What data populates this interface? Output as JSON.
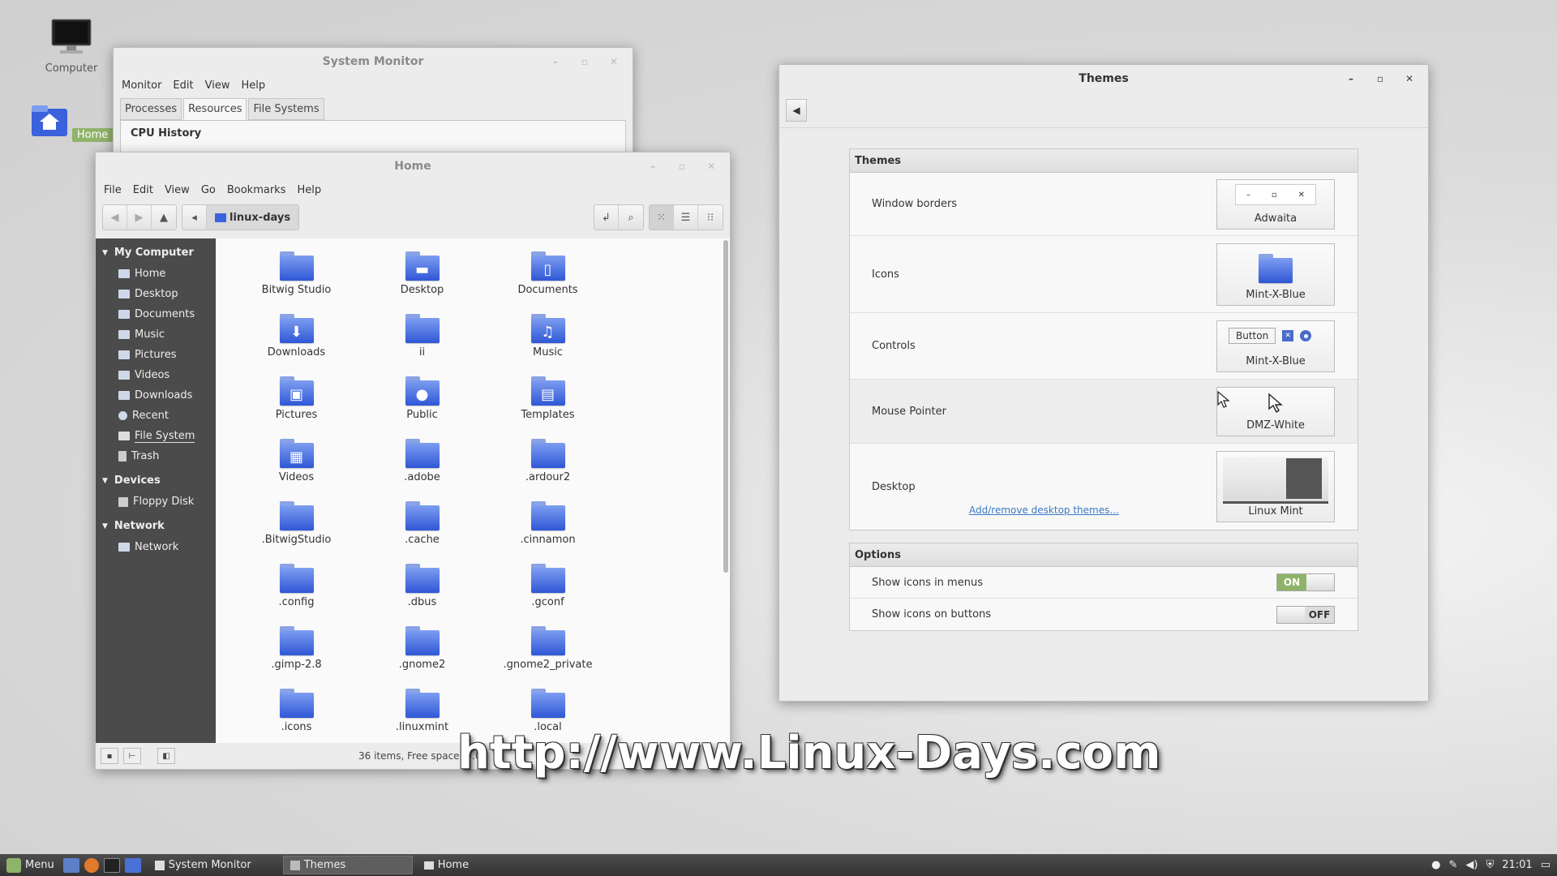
{
  "desktop": {
    "icons": [
      {
        "label": "Computer"
      },
      {
        "label": "Home"
      }
    ],
    "watermark": "http://www.Linux-Days.com"
  },
  "system_monitor": {
    "title": "System Monitor",
    "menu": [
      "Monitor",
      "Edit",
      "View",
      "Help"
    ],
    "tabs": [
      "Processes",
      "Resources",
      "File Systems"
    ],
    "active_tab": "Resources",
    "section": "CPU History"
  },
  "home": {
    "title": "Home",
    "menu": [
      "File",
      "Edit",
      "View",
      "Go",
      "Bookmarks",
      "Help"
    ],
    "path": "linux-days",
    "sidebar": {
      "my_computer": {
        "header": "My Computer",
        "items": [
          "Home",
          "Desktop",
          "Documents",
          "Music",
          "Pictures",
          "Videos",
          "Downloads",
          "Recent",
          "File System",
          "Trash"
        ]
      },
      "devices": {
        "header": "Devices",
        "items": [
          "Floppy Disk"
        ]
      },
      "network": {
        "header": "Network",
        "items": [
          "Network"
        ]
      }
    },
    "files": [
      {
        "name": "Bitwig Studio",
        "glyph": ""
      },
      {
        "name": "Desktop",
        "glyph": "▬"
      },
      {
        "name": "Documents",
        "glyph": "▯"
      },
      {
        "name": "Downloads",
        "glyph": "⬇"
      },
      {
        "name": "ii",
        "glyph": ""
      },
      {
        "name": "Music",
        "glyph": "♫"
      },
      {
        "name": "Pictures",
        "glyph": "▣"
      },
      {
        "name": "Public",
        "glyph": "●"
      },
      {
        "name": "Templates",
        "glyph": "▤"
      },
      {
        "name": "Videos",
        "glyph": "▦"
      },
      {
        "name": ".adobe",
        "glyph": ""
      },
      {
        "name": ".ardour2",
        "glyph": ""
      },
      {
        "name": ".BitwigStudio",
        "glyph": ""
      },
      {
        "name": ".cache",
        "glyph": ""
      },
      {
        "name": ".cinnamon",
        "glyph": ""
      },
      {
        "name": ".config",
        "glyph": ""
      },
      {
        "name": ".dbus",
        "glyph": ""
      },
      {
        "name": ".gconf",
        "glyph": ""
      },
      {
        "name": ".gimp-2.8",
        "glyph": ""
      },
      {
        "name": ".gnome2",
        "glyph": ""
      },
      {
        "name": ".gnome2_private",
        "glyph": ""
      },
      {
        "name": ".icons",
        "glyph": ""
      },
      {
        "name": ".linuxmint",
        "glyph": ""
      },
      {
        "name": ".local",
        "glyph": ""
      }
    ],
    "status": "36 items, Free space: 9.0"
  },
  "themes": {
    "title": "Themes",
    "section_themes": "Themes",
    "rows": {
      "window_borders": {
        "label": "Window borders",
        "value": "Adwaita"
      },
      "icons": {
        "label": "Icons",
        "value": "Mint-X-Blue"
      },
      "controls": {
        "label": "Controls",
        "value": "Mint-X-Blue",
        "button_text": "Button"
      },
      "mouse_pointer": {
        "label": "Mouse Pointer",
        "value": "DMZ-White"
      },
      "desktop": {
        "label": "Desktop",
        "value": "Linux Mint",
        "link": "Add/remove desktop themes..."
      }
    },
    "section_options": "Options",
    "options": {
      "icons_in_menus": {
        "label": "Show icons in menus",
        "state": "ON"
      },
      "icons_on_buttons": {
        "label": "Show icons on buttons",
        "state": "OFF"
      }
    }
  },
  "taskbar": {
    "menu_label": "Menu",
    "windows": [
      "System Monitor",
      "Themes",
      "Home"
    ],
    "active_window": "Themes",
    "clock": "21:01"
  },
  "colors": {
    "accent_green": "#8fb36a",
    "folder_blue": "#3a62dc",
    "link_blue": "#3c78c3"
  }
}
